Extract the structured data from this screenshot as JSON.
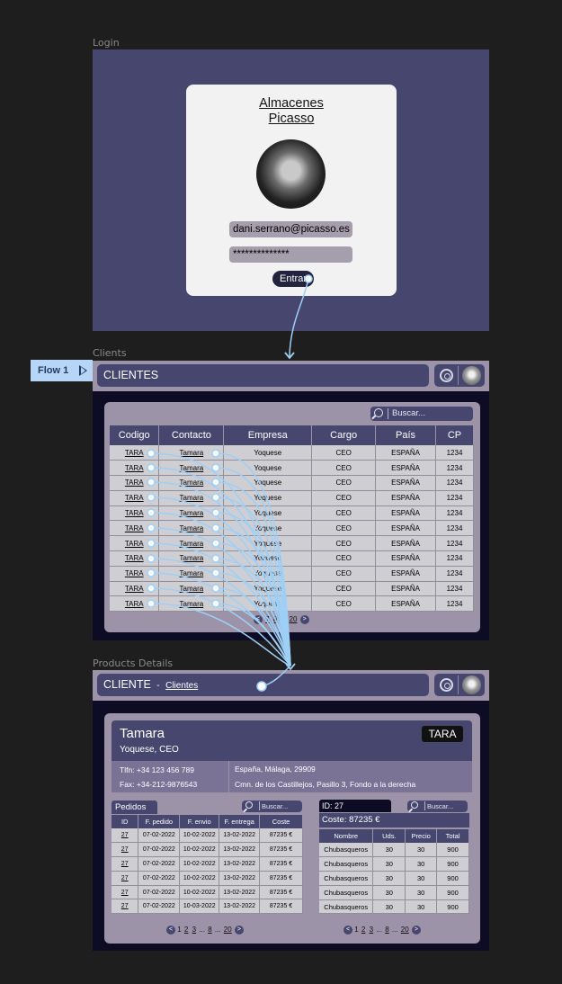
{
  "frames": {
    "login": "Login",
    "clients": "Clients",
    "products": "Products Details"
  },
  "flow_label": "Flow 1",
  "login": {
    "store_line1": "Almacenes",
    "store_line2": "Picasso",
    "email": "dani.serrano@picasso.es",
    "password": "**************",
    "enter_button": "Entrar"
  },
  "clients": {
    "title": "CLIENTES",
    "search_placeholder": "Buscar...",
    "columns": [
      "Codigo",
      "Contacto",
      "Empresa",
      "Cargo",
      "País",
      "CP"
    ],
    "rows": [
      [
        "TARA",
        "Tamara",
        "Yoquese",
        "CEO",
        "ESPAÑA",
        "1234"
      ],
      [
        "TARA",
        "Tamara",
        "Yoquese",
        "CEO",
        "ESPAÑA",
        "1234"
      ],
      [
        "TARA",
        "Tamara",
        "Yoquese",
        "CEO",
        "ESPAÑA",
        "1234"
      ],
      [
        "TARA",
        "Tamara",
        "Yoquese",
        "CEO",
        "ESPAÑA",
        "1234"
      ],
      [
        "TARA",
        "Tamara",
        "Yoquese",
        "CEO",
        "ESPAÑA",
        "1234"
      ],
      [
        "TARA",
        "Tamara",
        "Yoquese",
        "CEO",
        "ESPAÑA",
        "1234"
      ],
      [
        "TARA",
        "Tamara",
        "Yoquese",
        "CEO",
        "ESPAÑA",
        "1234"
      ],
      [
        "TARA",
        "Tamara",
        "Yoquese",
        "CEO",
        "ESPAÑA",
        "1234"
      ],
      [
        "TARA",
        "Tamara",
        "Yoquese",
        "CEO",
        "ESPAÑA",
        "1234"
      ],
      [
        "TARA",
        "Tamara",
        "Yoquese",
        "CEO",
        "ESPAÑA",
        "1234"
      ],
      [
        "TARA",
        "Tamara",
        "Yoquese",
        "CEO",
        "ESPAÑA",
        "1234"
      ]
    ],
    "pager": {
      "p7": "7",
      "p8": "8",
      "dots": "...",
      "last": "20"
    }
  },
  "products": {
    "title": "CLIENTE",
    "separator": "-",
    "breadcrumb_link": "Clientes",
    "customer": {
      "name": "Tamara",
      "subtitle": "Yoquese, CEO",
      "tag": "TARA",
      "phone": "Tlfn: +34 123 456 789",
      "fax": "Fax: +34-212-9876543",
      "location": "España, Málaga, 29909",
      "address": "Cmn. de los Castillejos, Pasillo 3, Fondo a la derecha"
    },
    "orders": {
      "tab": "Pedidos",
      "search_placeholder": "Buscar...",
      "columns": [
        "ID",
        "F. pedido",
        "F. envio",
        "F. entrega",
        "Coste"
      ],
      "rows": [
        [
          "27",
          "07-02-2022",
          "10-02-2022",
          "13-02-2022",
          "87235 €"
        ],
        [
          "27",
          "07-02-2022",
          "10-02-2022",
          "13-02-2022",
          "87235 €"
        ],
        [
          "27",
          "07-02-2022",
          "10-02-2022",
          "13-02-2022",
          "87235 €"
        ],
        [
          "27",
          "07-02-2022",
          "10-02-2022",
          "13-02-2022",
          "87235 €"
        ],
        [
          "27",
          "07-02-2022",
          "10-02-2022",
          "13-02-2022",
          "87235 €"
        ],
        [
          "27",
          "07-02-2022",
          "10-03-2022",
          "13-02-2022",
          "87235 €"
        ]
      ],
      "pager": {
        "p1": "1",
        "p2": "2",
        "p3": "3",
        "dots1": "...",
        "p8": "8",
        "dots2": "...",
        "last": "20"
      }
    },
    "detail": {
      "id_label": "ID: 27",
      "cost_label": "Coste: 87235 €",
      "search_placeholder": "Buscar...",
      "columns": [
        "Nombre",
        "Uds.",
        "Precio",
        "Total"
      ],
      "rows": [
        [
          "Chubasqueros",
          "30",
          "30",
          "900"
        ],
        [
          "Chubasqueros",
          "30",
          "30",
          "900"
        ],
        [
          "Chubasqueros",
          "30",
          "30",
          "900"
        ],
        [
          "Chubasqueros",
          "30",
          "30",
          "900"
        ],
        [
          "Chubasqueros",
          "30",
          "30",
          "900"
        ]
      ],
      "pager": {
        "p1": "1",
        "p2": "2",
        "p3": "3",
        "dots1": "...",
        "p8": "8",
        "dots2": "...",
        "last": "20"
      }
    }
  },
  "colors": {
    "canvas": "#1e1e1e",
    "frame_bg": "#46466e",
    "panel": "#9d93a9",
    "dark": "#0d0c24",
    "prototype_wire": "#9ecff7"
  },
  "icons": [
    "gear-icon",
    "avatar-icon",
    "search-icon",
    "play-icon",
    "chevron-left-icon",
    "chevron-right-icon"
  ]
}
